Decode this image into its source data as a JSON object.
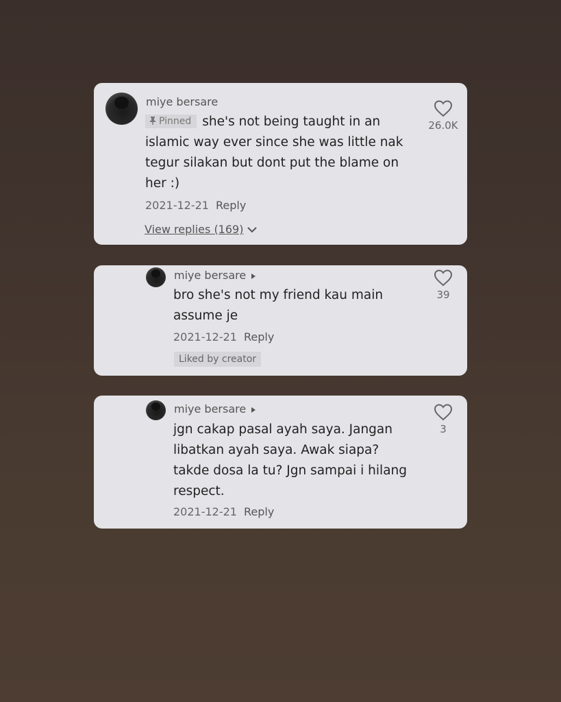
{
  "comments": [
    {
      "username": "miye bersare",
      "pinned_label": "Pinned",
      "lines": [
        "she's not being taught in an",
        "islamic way ever since she was little nak",
        "tegur silakan but dont put the blame on",
        "her :)"
      ],
      "date": "2021-12-21",
      "reply_label": "Reply",
      "likes": "26.0K",
      "view_replies": "View replies (169)"
    },
    {
      "username": "miye bersare",
      "lines": [
        "bro she's not my friend kau main",
        "assume je"
      ],
      "date": "2021-12-21",
      "reply_label": "Reply",
      "likes": "39",
      "badge": "Liked by creator"
    },
    {
      "username": "miye bersare",
      "lines": [
        "jgn cakap pasal ayah saya. Jangan",
        "libatkan ayah saya. Awak siapa?",
        "takde dosa la tu? Jgn sampai i hilang",
        "respect."
      ],
      "date": "2021-12-21",
      "reply_label": "Reply",
      "likes": "3"
    }
  ],
  "icons": {
    "like": "heart-outline-icon",
    "pin": "pin-icon",
    "expand": "chevron-down-icon",
    "reply_author": "play-arrow-icon"
  },
  "colors": {
    "background": "#3f322d",
    "card": "#e4e3e7",
    "text": "#222222",
    "muted": "#666666"
  }
}
